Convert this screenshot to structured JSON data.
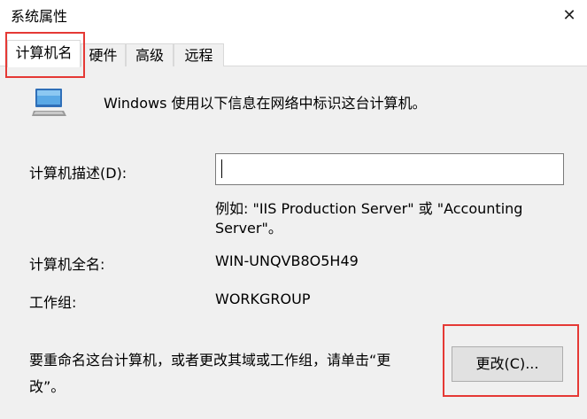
{
  "window": {
    "title": "系统属性",
    "close_glyph": "✕"
  },
  "tabs": [
    {
      "label": "计算机名",
      "active": true
    },
    {
      "label": "硬件",
      "active": false
    },
    {
      "label": "高级",
      "active": false
    },
    {
      "label": "远程",
      "active": false
    }
  ],
  "intro": "Windows 使用以下信息在网络中标识这台计算机。",
  "description": {
    "label": "计算机描述(D):",
    "value": "",
    "example": "例如: \"IIS Production Server\" 或 \"Accounting Server\"。"
  },
  "full_name": {
    "label": "计算机全名:",
    "value": "WIN-UNQVB8O5H49"
  },
  "workgroup": {
    "label": "工作组:",
    "value": "WORKGROUP"
  },
  "rename": {
    "text": "要重命名这台计算机，或者更改其域或工作组，请单击“更改”。",
    "button_label": "更改(C)..."
  },
  "icons": {
    "computer": "computer-icon",
    "close": "close-icon"
  },
  "colors": {
    "highlight": "#e53935",
    "panel_bg": "#f0f0f0",
    "button_bg": "#e1e1e1"
  }
}
